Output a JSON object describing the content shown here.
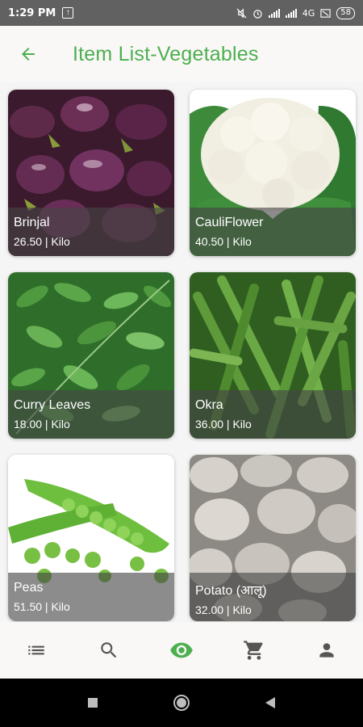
{
  "status_bar": {
    "time": "1:29 PM",
    "network": "4G",
    "battery": "58"
  },
  "header": {
    "title": "Item List-Vegetables"
  },
  "items": [
    {
      "name": "Brinjal",
      "price": "26.50 | Kilo"
    },
    {
      "name": "CauliFlower",
      "price": "40.50 | Kilo"
    },
    {
      "name": "Curry Leaves",
      "price": "18.00 | Kilo"
    },
    {
      "name": "Okra",
      "price": "36.00 | Kilo"
    },
    {
      "name": "Peas",
      "price": "51.50 | Kilo"
    },
    {
      "name": "Potato (आलू)",
      "price": "32.00 | Kilo"
    }
  ],
  "bottom_nav": {
    "items": [
      {
        "icon": "list-icon",
        "active": false
      },
      {
        "icon": "search-icon",
        "active": false
      },
      {
        "icon": "eye-icon",
        "active": true
      },
      {
        "icon": "cart-icon",
        "active": false
      },
      {
        "icon": "person-icon",
        "active": false
      }
    ]
  },
  "colors": {
    "accent": "#4caf50",
    "icon": "#555555",
    "status_bar": "#616161"
  }
}
